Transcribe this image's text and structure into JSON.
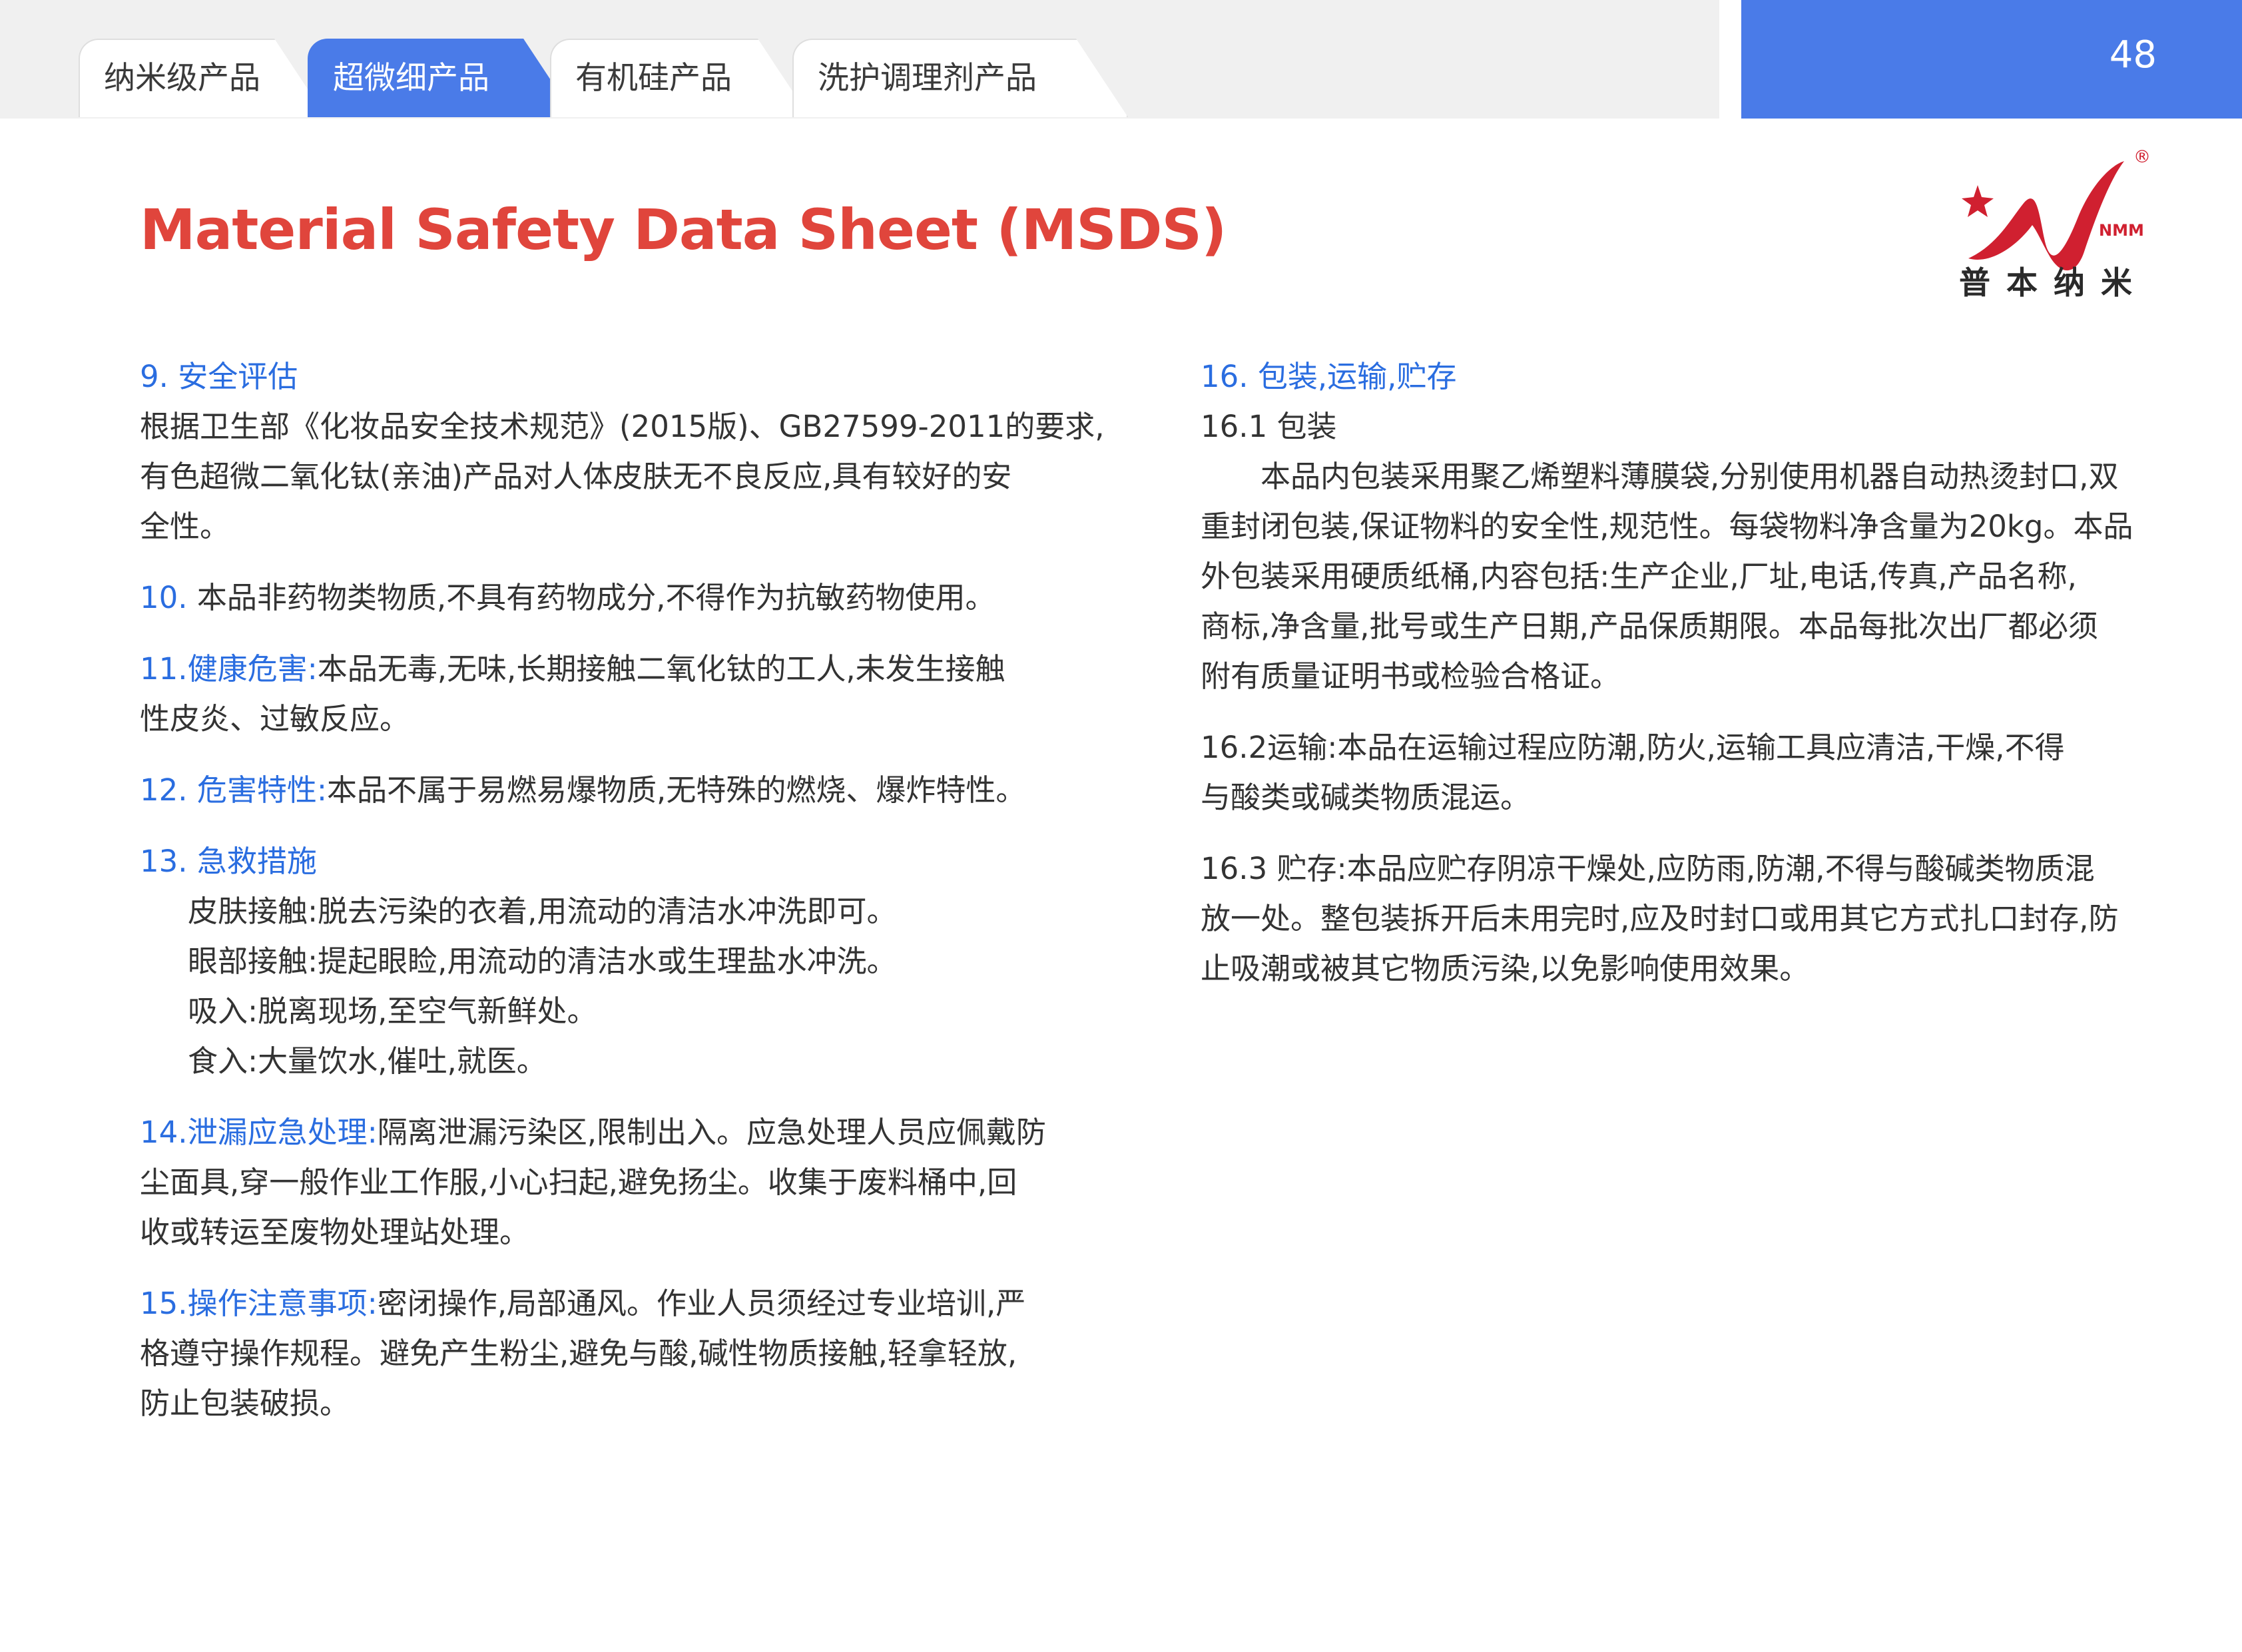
{
  "tabs": [
    {
      "label": "纳米级产品",
      "active": false
    },
    {
      "label": "超微细产品",
      "active": true
    },
    {
      "label": "有机硅产品",
      "active": false
    },
    {
      "label": "洗护调理剂产品",
      "active": false
    }
  ],
  "page_number": "48",
  "logo": {
    "brand": "NMM",
    "name": "普本纳米",
    "registered": "®"
  },
  "title": "Material Safety Data Sheet (MSDS)",
  "left": {
    "s9": {
      "heading": "9. 安全评估",
      "lines": [
        "根据卫生部《化妆品安全技术规范》(2015版)、GB27599-2011的要求,",
        "有色超微二氧化钛(亲油)产品对人体皮肤无不良反应,具有较好的安",
        "全性。"
      ]
    },
    "s10": {
      "num": "10.",
      "text": " 本品非药物类物质,不具有药物成分,不得作为抗敏药物使用。"
    },
    "s11": {
      "heading": "11.健康危害:",
      "line1": "本品无毒,无味,长期接触二氧化钛的工人,未发生接触",
      "line2": "性皮炎、过敏反应。"
    },
    "s12": {
      "heading": "12. 危害特性:",
      "text": "本品不属于易燃易爆物质,无特殊的燃烧、爆炸特性。"
    },
    "s13": {
      "heading": "13. 急救措施",
      "items": [
        "皮肤接触:脱去污染的衣着,用流动的清洁水冲洗即可。",
        "眼部接触:提起眼睑,用流动的清洁水或生理盐水冲洗。",
        "吸入:脱离现场,至空气新鲜处。",
        "食入:大量饮水,催吐,就医。"
      ]
    },
    "s14": {
      "heading": "14.泄漏应急处理:",
      "line1": "隔离泄漏污染区,限制出入。应急处理人员应佩戴防",
      "line2": "尘面具,穿一般作业工作服,小心扫起,避免扬尘。收集于废料桶中,回",
      "line3": "收或转运至废物处理站处理。"
    },
    "s15": {
      "heading": "15.操作注意事项:",
      "line1": "密闭操作,局部通风。作业人员须经过专业培训,严",
      "line2": "格遵守操作规程。避免产生粉尘,避免与酸,碱性物质接触,轻拿轻放,",
      "line3": "防止包装破损。"
    }
  },
  "right": {
    "s16": {
      "heading": "16. 包装,运输,贮存"
    },
    "s16_1": {
      "heading": "16.1 包装",
      "lines": [
        "本品内包装采用聚乙烯塑料薄膜袋,分别使用机器自动热烫封口,双",
        "重封闭包装,保证物料的安全性,规范性。每袋物料净含量为20kg。本品",
        "外包装采用硬质纸桶,内容包括:生产企业,厂址,电话,传真,产品名称,",
        "商标,净含量,批号或生产日期,产品保质期限。本品每批次出厂都必须",
        "附有质量证明书或检验合格证。"
      ]
    },
    "s16_2": {
      "lines": [
        "16.2运输:本品在运输过程应防潮,防火,运输工具应清洁,干燥,不得",
        "与酸类或碱类物质混运。"
      ]
    },
    "s16_3": {
      "lines": [
        "16.3 贮存:本品应贮存阴凉干燥处,应防雨,防潮,不得与酸碱类物质混",
        "放一处。整包装拆开后未用完时,应及时封口或用其它方式扎口封存,防",
        "止吸潮或被其它物质污染,以免影响使用效果。"
      ]
    }
  },
  "colors": {
    "accent_blue": "#4a7be8",
    "title_red": "#e0453c",
    "heading_blue": "#2a6de0"
  }
}
